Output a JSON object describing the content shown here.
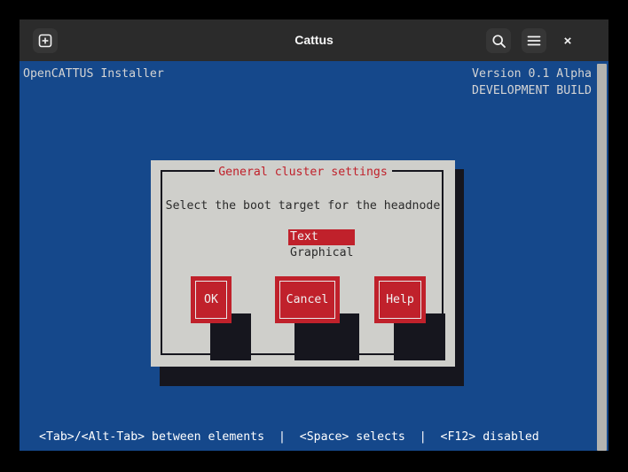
{
  "colors": {
    "terminal_bg": "#15488b",
    "titlebar_bg": "#2b2b2b",
    "dialog_bg": "#cfcfcb",
    "accent_red": "#c0212b",
    "shadow": "#16161e",
    "text_light": "#d4d4d4"
  },
  "titlebar": {
    "title": "Cattus",
    "new_tab_icon": "add-square-icon",
    "search_icon": "search-icon",
    "menu_icon": "hamburger-menu-icon",
    "close_label": "×"
  },
  "terminal": {
    "header_left": "OpenCATTUS Installer",
    "header_right_line1": "Version 0.1 Alpha",
    "header_right_line2": "DEVELOPMENT BUILD",
    "status_line": "<Tab>/<Alt-Tab> between elements  |  <Space> selects  |  <F12> disabled"
  },
  "dialog": {
    "title": "General cluster settings",
    "prompt": "Select the boot target for the headnode",
    "options": [
      {
        "label": "Text",
        "selected": true
      },
      {
        "label": "Graphical",
        "selected": false
      }
    ],
    "buttons": [
      {
        "label": "OK"
      },
      {
        "label": "Cancel"
      },
      {
        "label": "Help"
      }
    ]
  }
}
